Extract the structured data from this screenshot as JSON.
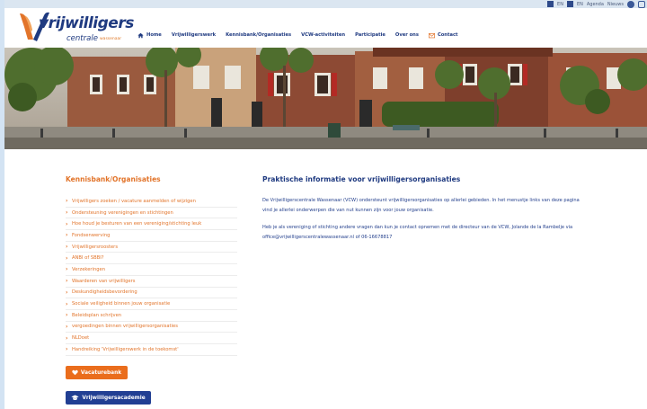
{
  "utility": {
    "item1": "EN",
    "item2": "EN",
    "item3": "Agenda",
    "item4": "Nieuws"
  },
  "logo": {
    "title": "vrijwilligers",
    "subtitle": "centrale",
    "town": "wassenaar"
  },
  "nav": {
    "items": [
      {
        "label": "Home",
        "icon": "home-icon"
      },
      {
        "label": "Vrijwilligerswerk"
      },
      {
        "label": "Kennisbank/Organisaties"
      },
      {
        "label": "VCW-activiteiten"
      },
      {
        "label": "Participatie"
      },
      {
        "label": "Over ons"
      },
      {
        "label": "Contact",
        "icon": "mail-icon"
      }
    ]
  },
  "sidebar": {
    "title": "Kennisbank/Organisaties",
    "items": [
      "Vrijwilligers zoeken / vacature aanmelden of wijzigen",
      "Ondersteuning verenigingen en stichtingen",
      "Hoe houd je besturen van een vereniging/stichting leuk",
      "Fondsenwerving",
      "Vrijwilligersroosters",
      "ANBI of SBBI?",
      "Verzekeringen",
      "Waarderen van vrijwilligers",
      "Deskundigheidsbevordering",
      "Sociale veiligheid binnen jouw organisatie",
      "Beleidsplan schrijven",
      "vergoedingen binnen vrijwilligersorganisaties",
      "NLDoet",
      "Handreiking 'Vrijwilligerswerk in de toekomst'"
    ],
    "btn_vacaturebank": "Vacaturebank",
    "btn_academie": "Vrijwilligersacademie"
  },
  "main": {
    "title": "Praktische informatie voor vrijwilligersorganisaties",
    "p1": "De Vrijwilligerscentrale Wassenaar (VCW) ondersteunt vrijwilligersorganisaties op allerlei gebieden. In het menustje links van deze pagina vind je allerlei onderwerpen die van nut kunnen zijn voor jouw organisatie.",
    "p2": "Heb je als vereniging of stichting andere vragen dan kun je contact opnemen met de directeur van de VCW, Jolande de la Rambelje via office@vrijwilligerscentralewassenaar.nl of 06-16678817"
  },
  "colors": {
    "brand_blue": "#1f3a80",
    "accent_orange": "#e2742a",
    "button_orange": "#ea6d1c",
    "button_blue": "#213f93"
  }
}
